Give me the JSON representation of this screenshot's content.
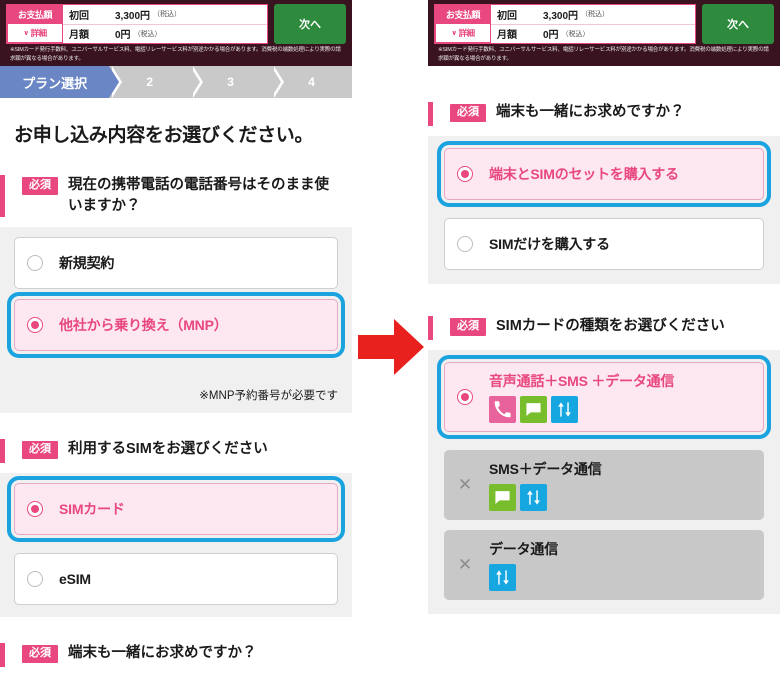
{
  "header": {
    "pay_label": "お支払額",
    "detail_label": "詳細",
    "detail_chevron": "∨",
    "rows": [
      {
        "key": "初回",
        "value": "3,300円",
        "tax": "（税込）"
      },
      {
        "key": "月額",
        "value": "0円",
        "tax": "（税込）"
      }
    ],
    "next_button": "次へ",
    "fineprint": "※SIMカード発行手数料、ユニバーサルサービス料、電話リレーサービス料が別途かかる場合があります。消費税の端数処理により実際の請求額が異なる場合があります。"
  },
  "stepper": {
    "steps": [
      {
        "label": "プラン選択",
        "active": true
      },
      {
        "label": "2",
        "active": false
      },
      {
        "label": "3",
        "active": false
      },
      {
        "label": "4",
        "active": false
      }
    ]
  },
  "left_panel": {
    "page_title": "お申し込み内容をお選びください。",
    "q1": {
      "required_badge": "必須",
      "question": "現在の携帯電話の電話番号はそのまま使いますか？",
      "options": [
        {
          "label": "新規契約",
          "selected": false
        },
        {
          "label": "他社から乗り換え（MNP）",
          "selected": true
        }
      ],
      "note": "※MNP予約番号が必要です"
    },
    "q2": {
      "required_badge": "必須",
      "question": "利用するSIMをお選びください",
      "options": [
        {
          "label": "SIMカード",
          "selected": true
        },
        {
          "label": "eSIM",
          "selected": false
        }
      ]
    },
    "q3": {
      "required_badge": "必須",
      "question": "端末も一緒にお求めですか？"
    }
  },
  "right_panel": {
    "q1": {
      "required_badge": "必須",
      "question": "端末も一緒にお求めですか？",
      "options": [
        {
          "label": "端末とSIMのセットを購入する",
          "selected": true
        },
        {
          "label": "SIMだけを購入する",
          "selected": false
        }
      ]
    },
    "q2": {
      "required_badge": "必須",
      "question": "SIMカードの種類をお選びください",
      "options": [
        {
          "label": "音声通話＋SMS ＋データ通信",
          "selected": true,
          "disabled": false,
          "icons": [
            "phone-icon",
            "sms-icon",
            "data-icon"
          ]
        },
        {
          "label": "SMS＋データ通信",
          "selected": false,
          "disabled": true,
          "icons": [
            "sms-icon",
            "data-icon"
          ]
        },
        {
          "label": "データ通信",
          "selected": false,
          "disabled": true,
          "icons": [
            "data-icon"
          ]
        }
      ]
    }
  },
  "annotation": {
    "arrow": "right-arrow",
    "arrow_color": "#e8201e"
  },
  "colors": {
    "brand_pink": "#e8487f",
    "highlight_blue": "#1ba3e0",
    "next_green": "#2e8b3d",
    "step_active": "#6b86c4",
    "tile_phone": "#e8629c",
    "tile_sms": "#78bd2b",
    "tile_data": "#16a7e0"
  }
}
